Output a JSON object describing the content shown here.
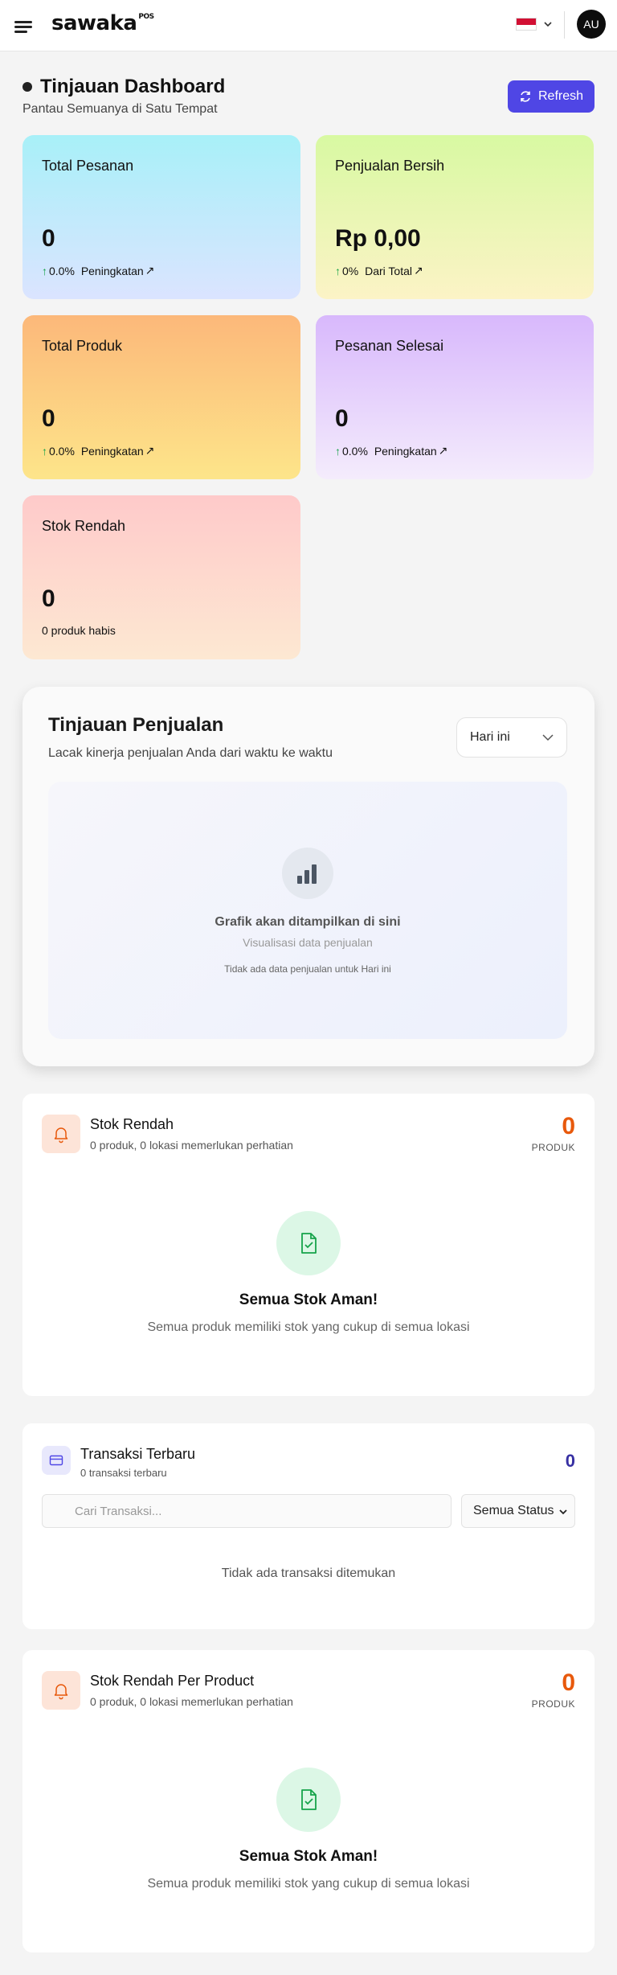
{
  "header": {
    "logo": "sawaka",
    "logo_badge": "POS",
    "avatar_initials": "AU",
    "flag_colors": [
      "#d21034",
      "#ffffff"
    ]
  },
  "page": {
    "title": "Tinjauan Dashboard",
    "subtitle": "Pantau Semuanya di Satu Tempat",
    "refresh_label": "Refresh"
  },
  "stats": [
    {
      "title": "Total Pesanan",
      "value": "0",
      "change": "0.0%",
      "note": "Peningkatan"
    },
    {
      "title": "Penjualan Bersih",
      "value": "Rp 0,00",
      "change": "0%",
      "note": "Dari Total"
    },
    {
      "title": "Total Produk",
      "value": "0",
      "change": "0.0%",
      "note": "Peningkatan"
    },
    {
      "title": "Pesanan Selesai",
      "value": "0",
      "change": "0.0%",
      "note": "Peningkatan"
    },
    {
      "title": "Stok Rendah",
      "value": "0",
      "note": "0 produk habis"
    }
  ],
  "overview": {
    "title": "Tinjauan Penjualan",
    "subtitle": "Lacak kinerja penjualan Anda dari waktu ke waktu",
    "period": "Hari ini",
    "placeholder_title": "Grafik akan ditampilkan di sini",
    "placeholder_sub": "Visualisasi data penjualan",
    "empty_note": "Tidak ada data penjualan untuk Hari ini"
  },
  "low_stock": {
    "title": "Stok Rendah",
    "subtitle": "0 produk, 0 lokasi memerlukan perhatian",
    "count": "0",
    "count_label": "PRODUK",
    "ok_title": "Semua Stok Aman!",
    "ok_sub": "Semua produk memiliki stok yang cukup di semua lokasi"
  },
  "transactions": {
    "title": "Transaksi Terbaru",
    "subtitle": "0 transaksi terbaru",
    "count": "0",
    "search_placeholder": "Cari Transaksi...",
    "status_filter": "Semua Status",
    "empty": "Tidak ada transaksi ditemukan"
  },
  "low_stock_product": {
    "title": "Stok Rendah Per Product",
    "subtitle": "0 produk, 0 lokasi memerlukan perhatian",
    "count": "0",
    "count_label": "PRODUK",
    "ok_title": "Semua Stok Aman!",
    "ok_sub": "Semua produk memiliki stok yang cukup di semua lokasi"
  }
}
